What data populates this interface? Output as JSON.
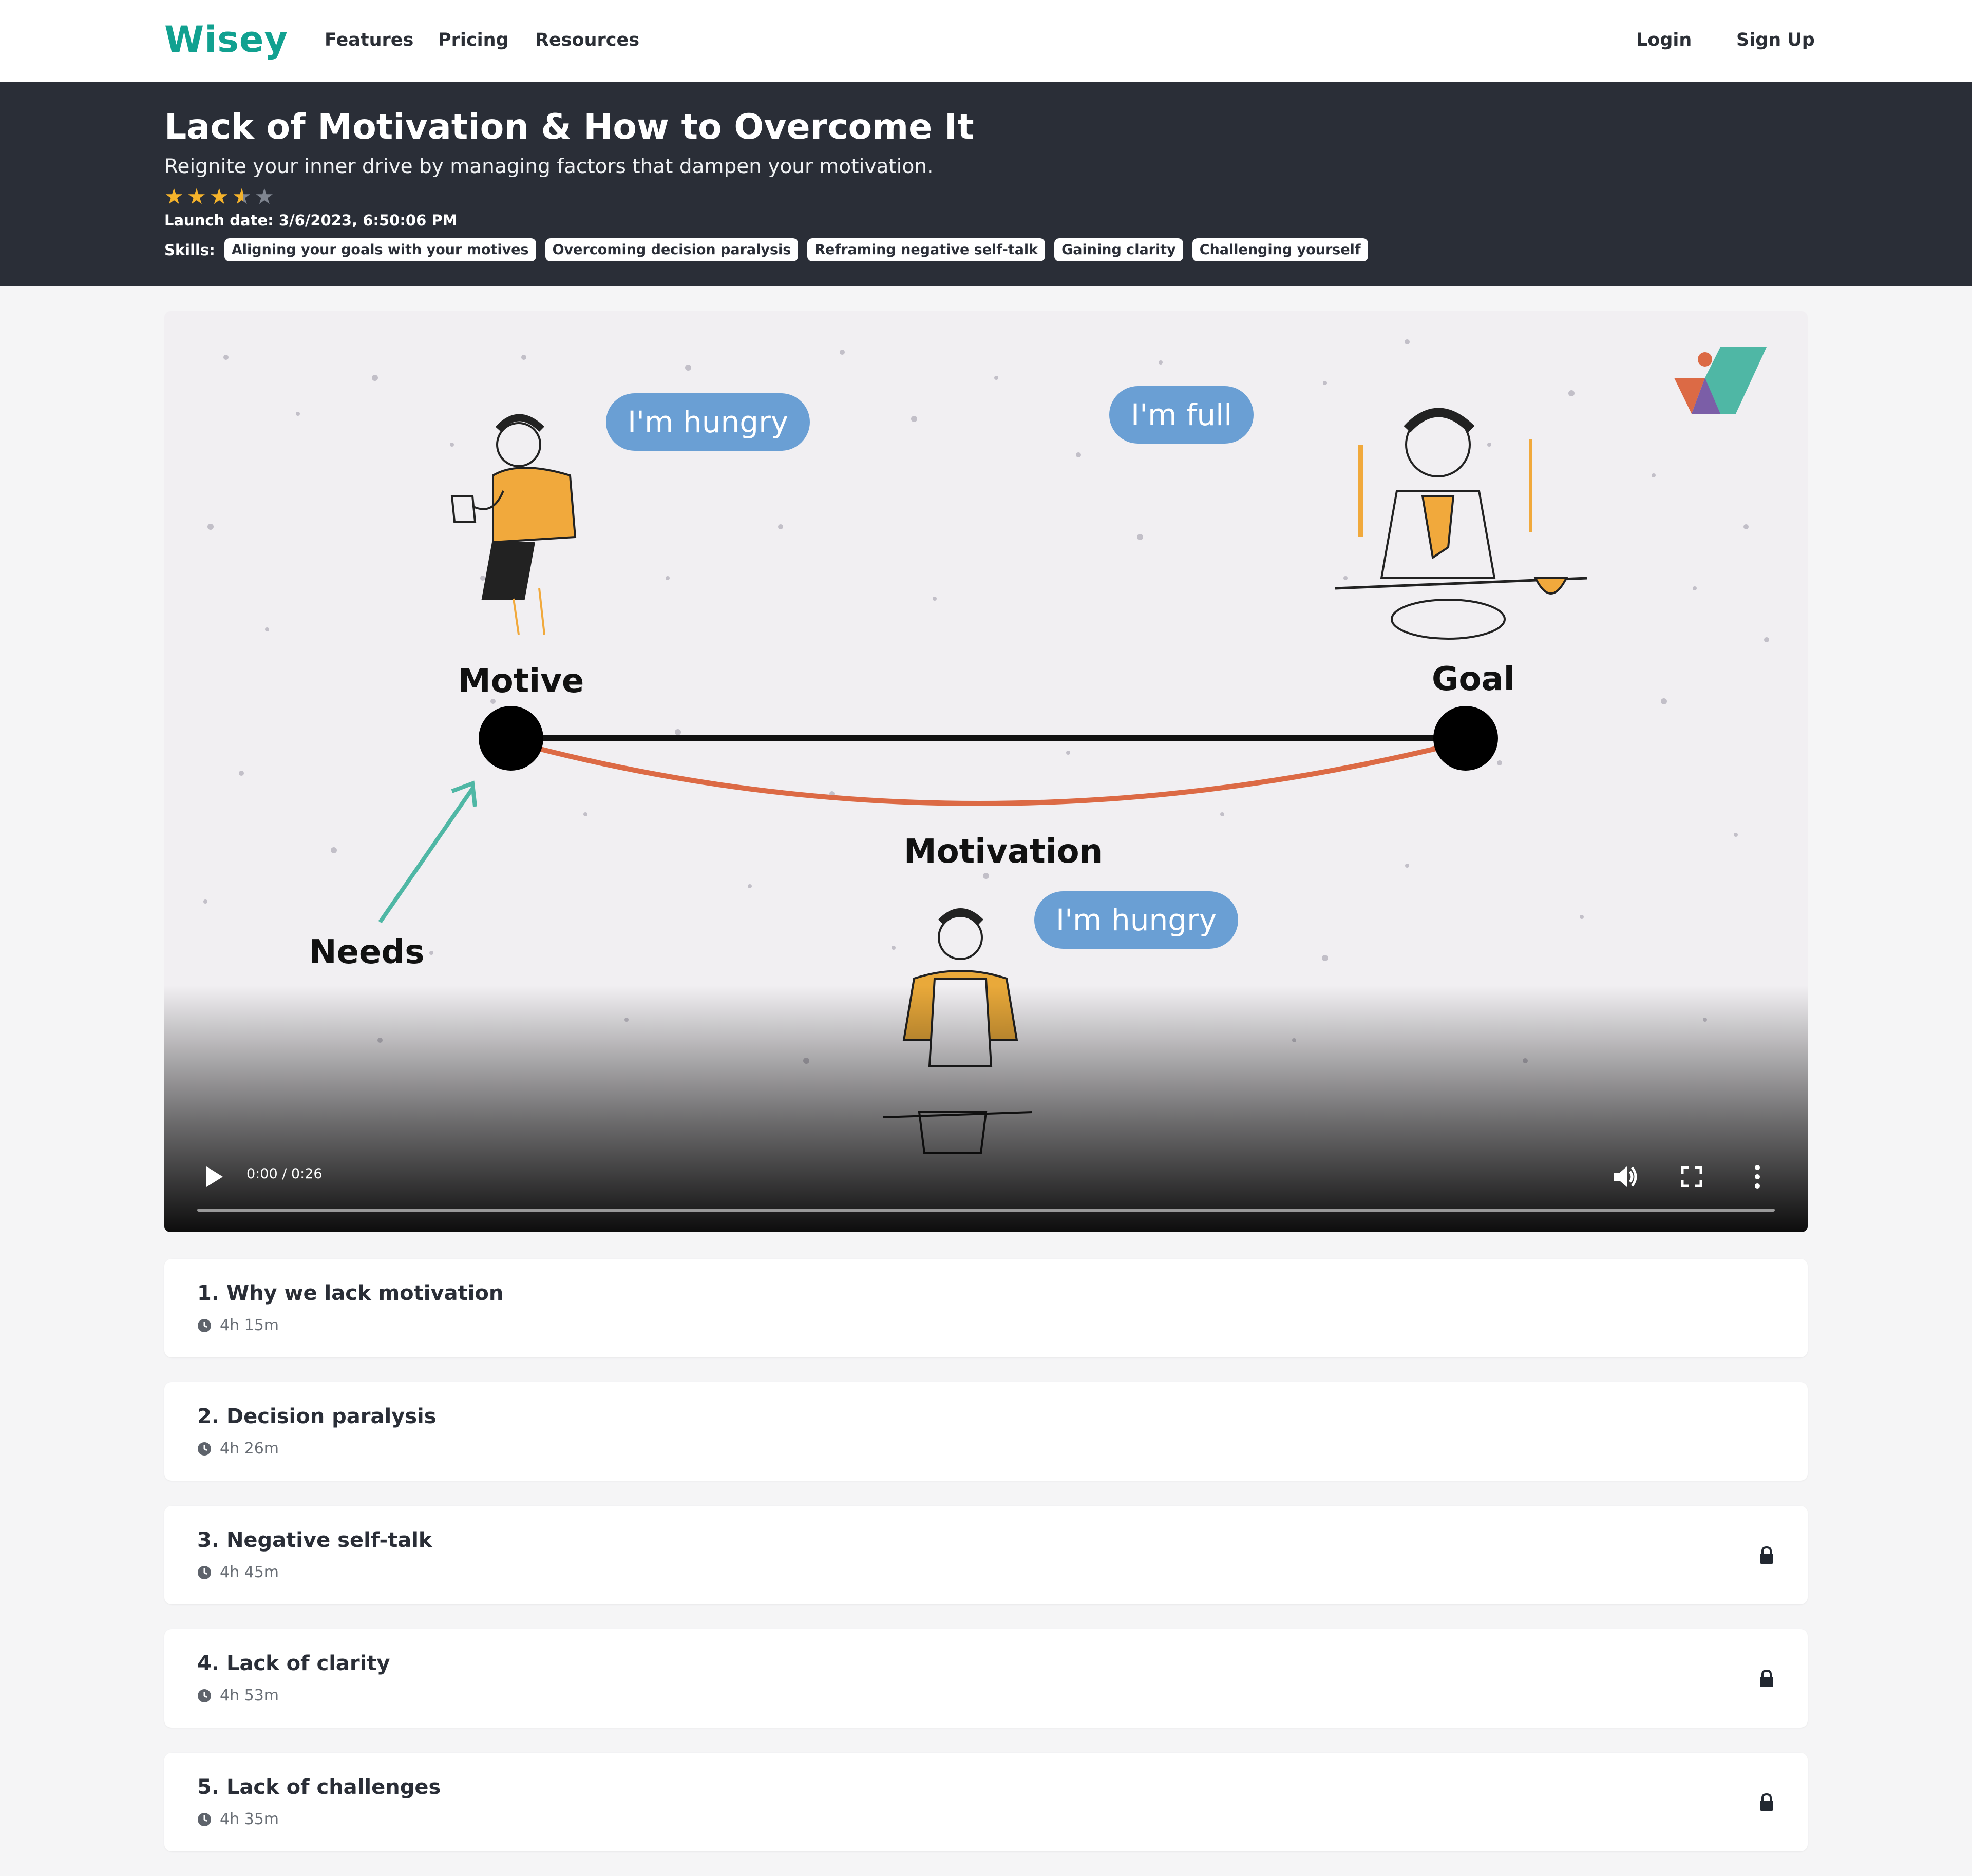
{
  "nav": {
    "logo": "Wisey",
    "links": [
      "Features",
      "Pricing",
      "Resources"
    ],
    "login": "Login",
    "signup": "Sign Up"
  },
  "course": {
    "title": "Lack of Motivation & How to Overcome It",
    "subtitle": "Reignite your inner drive by managing factors that dampen your motivation.",
    "rating": 3.5,
    "rating_max": 5,
    "launch_date": "Launch date: 3/6/2023, 6:50:06 PM",
    "skills_label": "Skills:",
    "skills": [
      "Aligning your goals with your motives",
      "Overcoming decision paralysis",
      "Reframing negative self-talk",
      "Gaining clarity",
      "Challenging yourself"
    ]
  },
  "video": {
    "time": "0:00 / 0:26",
    "progress": 0,
    "scene": {
      "bubbles": [
        "I'm hungry",
        "I'm full",
        "I'm hungry"
      ],
      "labels": [
        "Motive",
        "Goal",
        "Motivation",
        "Needs"
      ]
    },
    "controls": [
      "play-icon",
      "volume-icon",
      "fullscreen-icon",
      "more-icon"
    ]
  },
  "chapters": [
    {
      "title": "1. Why we lack motivation",
      "duration": "4h 15m",
      "locked": false
    },
    {
      "title": "2. Decision paralysis",
      "duration": "4h 26m",
      "locked": false
    },
    {
      "title": "3. Negative self-talk",
      "duration": "4h 45m",
      "locked": true
    },
    {
      "title": "4. Lack of clarity",
      "duration": "4h 53m",
      "locked": true
    },
    {
      "title": "5. Lack of challenges",
      "duration": "4h 35m",
      "locked": true
    }
  ],
  "colors": {
    "brand": "#11a190",
    "hero_bg": "#2a2e37",
    "star": "#f5b32b",
    "bubble": "#6a9fd4",
    "motivation_line": "#dc6a45"
  }
}
